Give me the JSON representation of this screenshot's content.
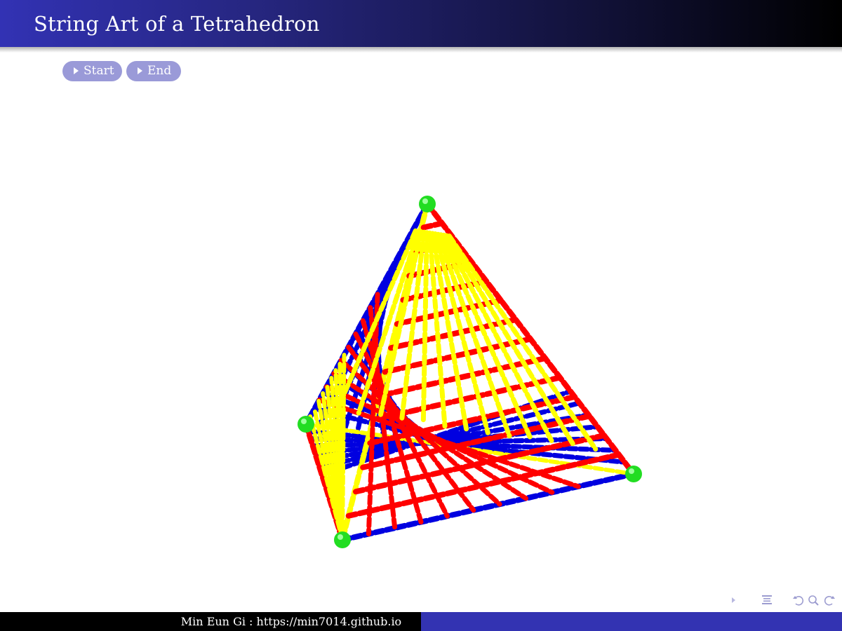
{
  "header": {
    "title": "String Art of a Tetrahedron"
  },
  "controls": {
    "start_label": "Start",
    "end_label": "End"
  },
  "footer": {
    "author_link": "Min Eun Gi : https://min7014.github.io"
  },
  "navigation_icons": [
    "slide-nav-arrow-icon",
    "section-nav-icon",
    "undo-icon",
    "search-icon",
    "redo-icon"
  ],
  "colors": {
    "header_start": "#3232b4",
    "header_end": "#000000",
    "button_bg": "#9a9ad8",
    "footer_left": "#000000",
    "footer_right": "#3333b2",
    "string_red": "#ff0000",
    "string_blue": "#0000e0",
    "string_yellow": "#ffff00",
    "vertex_green": "#22dd22"
  }
}
